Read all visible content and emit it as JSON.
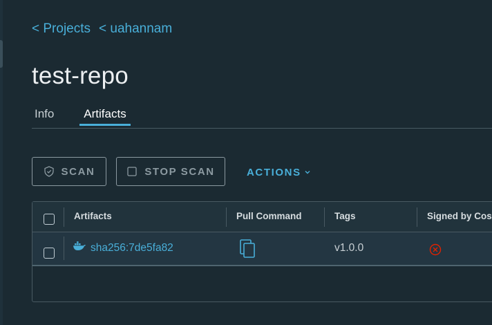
{
  "breadcrumb": [
    {
      "label": "< Projects"
    },
    {
      "label": "< uahannam"
    }
  ],
  "page_title": "test-repo",
  "tabs": [
    {
      "label": "Info",
      "active": false
    },
    {
      "label": "Artifacts",
      "active": true
    }
  ],
  "toolbar": {
    "scan_label": "SCAN",
    "stop_scan_label": "STOP SCAN",
    "actions_label": "ACTIONS"
  },
  "grid": {
    "columns": [
      "Artifacts",
      "Pull Command",
      "Tags",
      "Signed by Cosign"
    ],
    "rows": [
      {
        "artifact": "sha256:7de5fa82",
        "artifact_icon": "docker-icon",
        "pull_command_icon": "copy-icon",
        "tag": "v1.0.0",
        "signed_icon": "x-circle-icon",
        "signed": false
      }
    ]
  },
  "colors": {
    "background": "#1b2a32",
    "accent": "#49afd9",
    "danger": "#e12200",
    "border": "#495a63"
  }
}
